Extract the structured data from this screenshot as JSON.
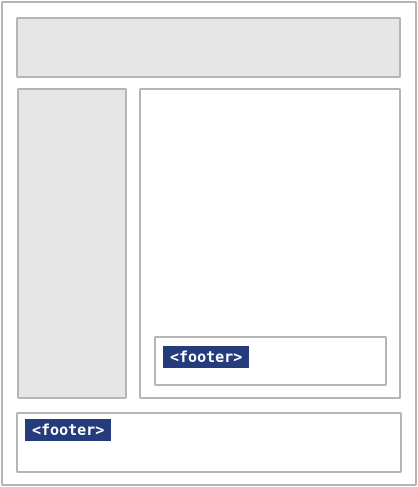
{
  "colors": {
    "region_fill": "#e6e6e6",
    "border": "#b5b5b5",
    "tag_background": "#243c7c",
    "tag_text": "#ffffff"
  },
  "inner_footer": {
    "tag_label": "<footer>"
  },
  "page_footer": {
    "tag_label": "<footer>"
  }
}
